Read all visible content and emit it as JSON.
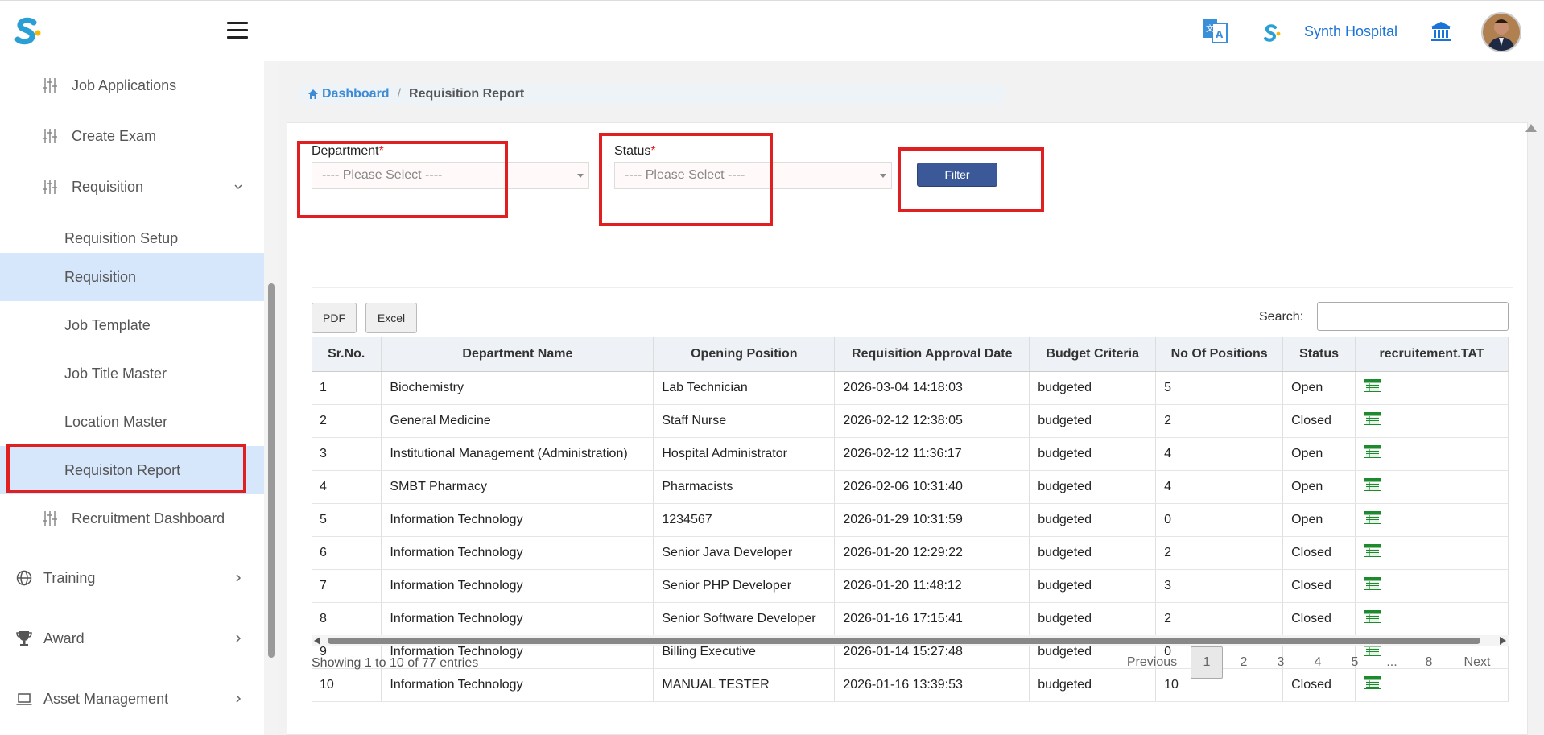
{
  "header": {
    "hospital_name": "Synth Hospital"
  },
  "sidebar": {
    "items": [
      {
        "label": "Job Applications",
        "icon": "sliders-icon"
      },
      {
        "label": "Create Exam",
        "icon": "sliders-icon"
      },
      {
        "label": "Requisition",
        "icon": "sliders-icon",
        "expanded": true
      },
      {
        "label": "Requisition Setup"
      },
      {
        "label": "Requisition",
        "active": true
      },
      {
        "label": "Job Template"
      },
      {
        "label": "Job Title Master"
      },
      {
        "label": "Location Master"
      },
      {
        "label": "Requisiton Report",
        "active": true
      },
      {
        "label": "Recruitment Dashboard",
        "icon": "sliders-icon"
      },
      {
        "label": "Training",
        "icon": "globe-icon"
      },
      {
        "label": "Award",
        "icon": "trophy-icon"
      },
      {
        "label": "Asset Management",
        "icon": "laptop-icon"
      }
    ]
  },
  "breadcrumb": {
    "home": "Dashboard",
    "separator": "/",
    "current": "Requisition Report"
  },
  "filters": {
    "department_label": "Department",
    "status_label": "Status",
    "required_mark": "*",
    "department_value": "---- Please Select ----",
    "status_value": "---- Please Select ----",
    "filter_button": "Filter"
  },
  "toolbar": {
    "pdf": "PDF",
    "excel": "Excel",
    "search_label": "Search:",
    "search_value": ""
  },
  "table": {
    "columns": [
      "Sr.No.",
      "Department Name",
      "Opening Position",
      "Requisition Approval Date",
      "Budget Criteria",
      "No Of Positions",
      "Status",
      "recruitement.TAT"
    ],
    "rows": [
      [
        "1",
        "Biochemistry",
        "Lab Technician",
        "2026-03-04 14:18:03",
        "budgeted",
        "5",
        "Open"
      ],
      [
        "2",
        "General Medicine",
        "Staff Nurse",
        "2026-02-12 12:38:05",
        "budgeted",
        "2",
        "Closed"
      ],
      [
        "3",
        "Institutional Management (Administration)",
        "Hospital Administrator",
        "2026-02-12 11:36:17",
        "budgeted",
        "4",
        "Open"
      ],
      [
        "4",
        "SMBT Pharmacy",
        "Pharmacists",
        "2026-02-06 10:31:40",
        "budgeted",
        "4",
        "Open"
      ],
      [
        "5",
        "Information Technology",
        "1234567",
        "2026-01-29 10:31:59",
        "budgeted",
        "0",
        "Open"
      ],
      [
        "6",
        "Information Technology",
        "Senior Java Developer",
        "2026-01-20 12:29:22",
        "budgeted",
        "2",
        "Closed"
      ],
      [
        "7",
        "Information Technology",
        "Senior PHP Developer",
        "2026-01-20 11:48:12",
        "budgeted",
        "3",
        "Closed"
      ],
      [
        "8",
        "Information Technology",
        "Senior Software Developer",
        "2026-01-16 17:15:41",
        "budgeted",
        "2",
        "Closed"
      ],
      [
        "9",
        "Information Technology",
        "Billing Executive",
        "2026-01-14 15:27:48",
        "budgeted",
        "0",
        ""
      ],
      [
        "10",
        "Information Technology",
        "MANUAL TESTER",
        "2026-01-16 13:39:53",
        "budgeted",
        "10",
        "Closed"
      ]
    ]
  },
  "pagination": {
    "info": "Showing 1 to 10 of 77 entries",
    "previous": "Previous",
    "pages": [
      "1",
      "2",
      "3",
      "4",
      "5",
      "...",
      "8"
    ],
    "current": "1",
    "next": "Next"
  },
  "colors": {
    "accent": "#1a73d8",
    "highlight_box": "#e02020",
    "filter_button": "#3b5998",
    "active_sidebar": "#d6e6fb",
    "tat_icon": "#1e8a2e"
  }
}
